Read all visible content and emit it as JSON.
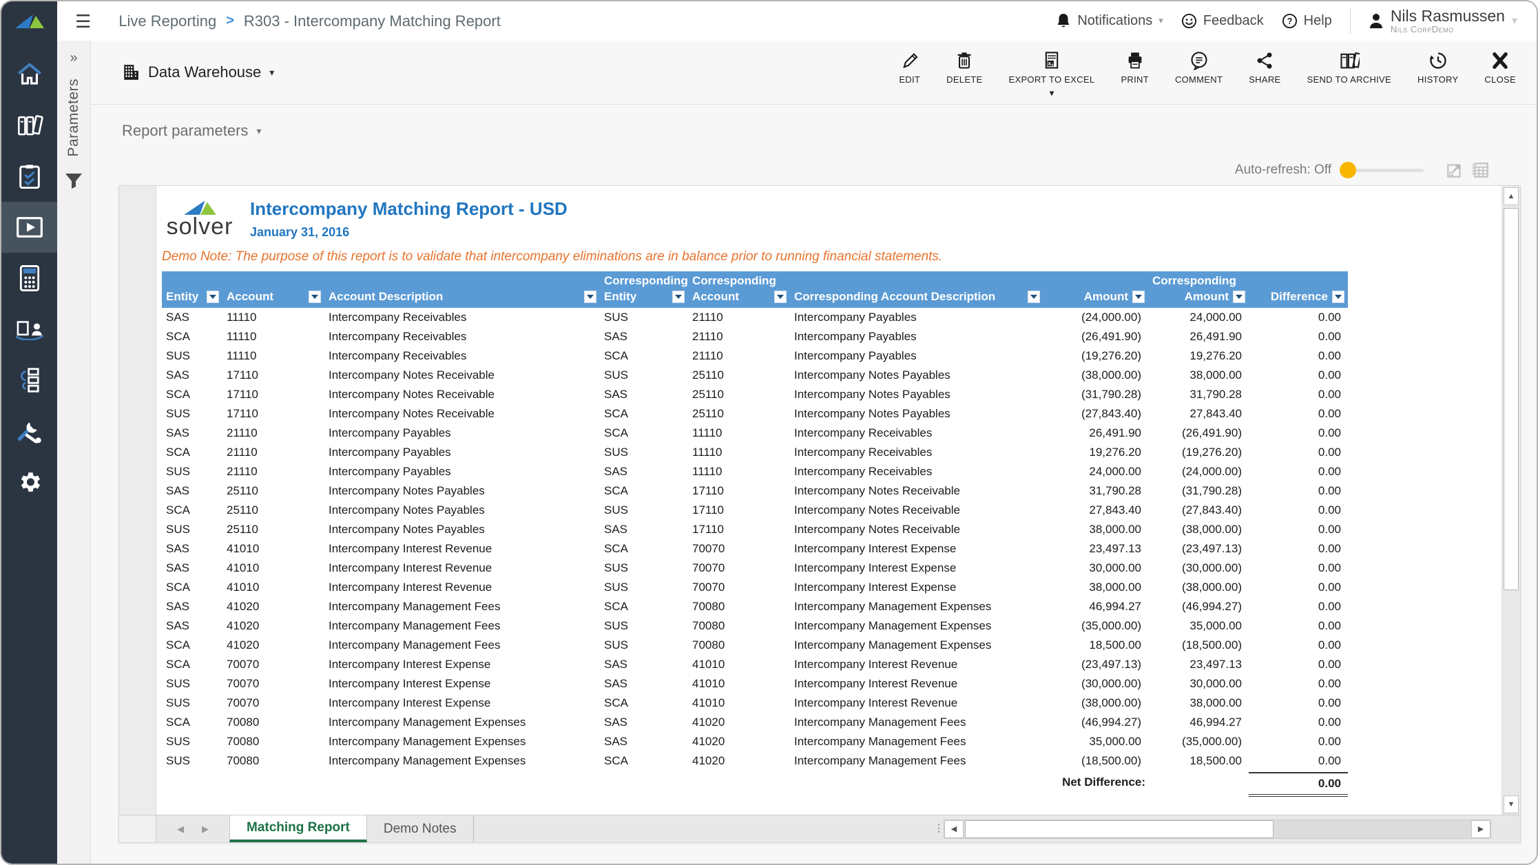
{
  "topbar": {
    "breadcrumb_root": "Live Reporting",
    "breadcrumb_sep": ">",
    "breadcrumb_current": "R303 - Intercompany Matching Report",
    "notifications_label": "Notifications",
    "feedback_label": "Feedback",
    "help_label": "Help",
    "user": {
      "name": "Nils Rasmussen",
      "org": "Nils CorpDemo"
    }
  },
  "subheader": {
    "data_warehouse_label": "Data Warehouse",
    "toolbar": [
      {
        "icon": "edit-icon",
        "label": "EDIT"
      },
      {
        "icon": "delete-icon",
        "label": "DELETE"
      },
      {
        "icon": "export-excel-icon",
        "label": "EXPORT TO EXCEL",
        "has_dropdown": true
      },
      {
        "icon": "print-icon",
        "label": "PRINT"
      },
      {
        "icon": "comment-icon",
        "label": "COMMENT"
      },
      {
        "icon": "share-icon",
        "label": "SHARE"
      },
      {
        "icon": "archive-icon",
        "label": "SEND TO ARCHIVE"
      },
      {
        "icon": "history-icon",
        "label": "HISTORY"
      },
      {
        "icon": "close-icon",
        "label": "CLOSE"
      }
    ]
  },
  "parameters_rail": {
    "label": "Parameters"
  },
  "main": {
    "report_parameters_label": "Report parameters",
    "auto_refresh_label": "Auto-refresh: Off"
  },
  "report": {
    "logo_text": "solver",
    "title": "Intercompany Matching Report - USD",
    "date": "January 31, 2016",
    "demo_note": "Demo Note: The purpose of this report is to validate that intercompany eliminations are in balance prior to running financial statements.",
    "table": {
      "columns": [
        {
          "top": "",
          "label": "Entity",
          "numeric": false
        },
        {
          "top": "",
          "label": "Account",
          "numeric": false
        },
        {
          "top": "",
          "label": "Account Description",
          "numeric": false
        },
        {
          "top": "Corresponding",
          "label": "Entity",
          "numeric": false
        },
        {
          "top": "Corresponding",
          "label": "Account",
          "numeric": false
        },
        {
          "top": "",
          "label": "Corresponding Account Description",
          "numeric": false
        },
        {
          "top": "",
          "label": "Amount",
          "numeric": true
        },
        {
          "top": "Corresponding",
          "label": "Amount",
          "numeric": true
        },
        {
          "top": "",
          "label": "Difference",
          "numeric": true
        }
      ],
      "rows": [
        [
          "SAS",
          "11110",
          "Intercompany Receivables",
          "SUS",
          "21110",
          "Intercompany Payables",
          "(24,000.00)",
          "24,000.00",
          "0.00"
        ],
        [
          "SCA",
          "11110",
          "Intercompany Receivables",
          "SAS",
          "21110",
          "Intercompany Payables",
          "(26,491.90)",
          "26,491.90",
          "0.00"
        ],
        [
          "SUS",
          "11110",
          "Intercompany Receivables",
          "SCA",
          "21110",
          "Intercompany Payables",
          "(19,276.20)",
          "19,276.20",
          "0.00"
        ],
        [
          "SAS",
          "17110",
          "Intercompany Notes Receivable",
          "SUS",
          "25110",
          "Intercompany Notes Payables",
          "(38,000.00)",
          "38,000.00",
          "0.00"
        ],
        [
          "SCA",
          "17110",
          "Intercompany Notes Receivable",
          "SAS",
          "25110",
          "Intercompany Notes Payables",
          "(31,790.28)",
          "31,790.28",
          "0.00"
        ],
        [
          "SUS",
          "17110",
          "Intercompany Notes Receivable",
          "SCA",
          "25110",
          "Intercompany Notes Payables",
          "(27,843.40)",
          "27,843.40",
          "0.00"
        ],
        [
          "SAS",
          "21110",
          "Intercompany Payables",
          "SCA",
          "11110",
          "Intercompany Receivables",
          "26,491.90",
          "(26,491.90)",
          "0.00"
        ],
        [
          "SCA",
          "21110",
          "Intercompany Payables",
          "SUS",
          "11110",
          "Intercompany Receivables",
          "19,276.20",
          "(19,276.20)",
          "0.00"
        ],
        [
          "SUS",
          "21110",
          "Intercompany Payables",
          "SAS",
          "11110",
          "Intercompany Receivables",
          "24,000.00",
          "(24,000.00)",
          "0.00"
        ],
        [
          "SAS",
          "25110",
          "Intercompany Notes Payables",
          "SCA",
          "17110",
          "Intercompany Notes Receivable",
          "31,790.28",
          "(31,790.28)",
          "0.00"
        ],
        [
          "SCA",
          "25110",
          "Intercompany Notes Payables",
          "SUS",
          "17110",
          "Intercompany Notes Receivable",
          "27,843.40",
          "(27,843.40)",
          "0.00"
        ],
        [
          "SUS",
          "25110",
          "Intercompany Notes Payables",
          "SAS",
          "17110",
          "Intercompany Notes Receivable",
          "38,000.00",
          "(38,000.00)",
          "0.00"
        ],
        [
          "SAS",
          "41010",
          "Intercompany Interest Revenue",
          "SCA",
          "70070",
          "Intercompany Interest Expense",
          "23,497.13",
          "(23,497.13)",
          "0.00"
        ],
        [
          "SAS",
          "41010",
          "Intercompany Interest Revenue",
          "SUS",
          "70070",
          "Intercompany Interest Expense",
          "30,000.00",
          "(30,000.00)",
          "0.00"
        ],
        [
          "SCA",
          "41010",
          "Intercompany Interest Revenue",
          "SUS",
          "70070",
          "Intercompany Interest Expense",
          "38,000.00",
          "(38,000.00)",
          "0.00"
        ],
        [
          "SAS",
          "41020",
          "Intercompany Management Fees",
          "SCA",
          "70080",
          "Intercompany Management Expenses",
          "46,994.27",
          "(46,994.27)",
          "0.00"
        ],
        [
          "SAS",
          "41020",
          "Intercompany Management Fees",
          "SUS",
          "70080",
          "Intercompany Management Expenses",
          "(35,000.00)",
          "35,000.00",
          "0.00"
        ],
        [
          "SCA",
          "41020",
          "Intercompany Management Fees",
          "SUS",
          "70080",
          "Intercompany Management Expenses",
          "18,500.00",
          "(18,500.00)",
          "0.00"
        ],
        [
          "SCA",
          "70070",
          "Intercompany Interest Expense",
          "SAS",
          "41010",
          "Intercompany Interest Revenue",
          "(23,497.13)",
          "23,497.13",
          "0.00"
        ],
        [
          "SUS",
          "70070",
          "Intercompany Interest Expense",
          "SAS",
          "41010",
          "Intercompany Interest Revenue",
          "(30,000.00)",
          "30,000.00",
          "0.00"
        ],
        [
          "SUS",
          "70070",
          "Intercompany Interest Expense",
          "SCA",
          "41010",
          "Intercompany Interest Revenue",
          "(38,000.00)",
          "38,000.00",
          "0.00"
        ],
        [
          "SCA",
          "70080",
          "Intercompany Management Expenses",
          "SAS",
          "41020",
          "Intercompany Management Fees",
          "(46,994.27)",
          "46,994.27",
          "0.00"
        ],
        [
          "SUS",
          "70080",
          "Intercompany Management Expenses",
          "SAS",
          "41020",
          "Intercompany Management Fees",
          "35,000.00",
          "(35,000.00)",
          "0.00"
        ],
        [
          "SUS",
          "70080",
          "Intercompany Management Expenses",
          "SCA",
          "41020",
          "Intercompany Management Fees",
          "(18,500.00)",
          "18,500.00",
          "0.00"
        ]
      ],
      "net_difference_label": "Net Difference:",
      "net_difference_value": "0.00"
    },
    "tabs": [
      {
        "label": "Matching Report",
        "active": true
      },
      {
        "label": "Demo Notes",
        "active": false
      }
    ]
  },
  "colors": {
    "table_header_blue": "#5b9bd5",
    "title_blue": "#2176c0",
    "demo_note_orange": "#e8732c",
    "active_tab_green": "#1e7145",
    "autorefresh_knob_yellow": "#f7b500",
    "sidebar_dark": "#2b3542"
  }
}
